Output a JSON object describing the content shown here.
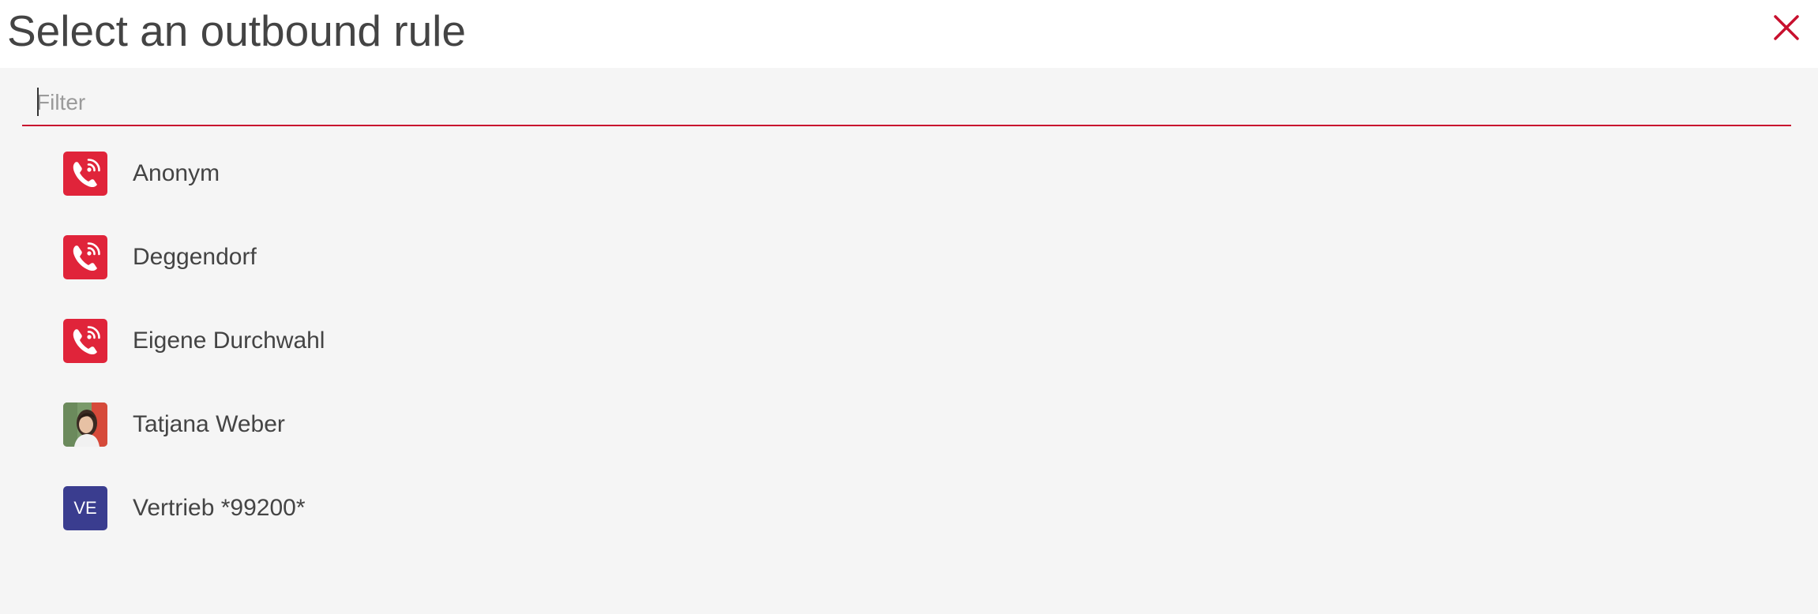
{
  "dialog": {
    "title": "Select an outbound rule",
    "close_icon": "close-icon",
    "accent_color": "#c8102e"
  },
  "filter": {
    "placeholder": "Filter",
    "value": ""
  },
  "items": [
    {
      "label": "Anonym",
      "icon": "phone-outbound-icon",
      "avatar_type": "rule"
    },
    {
      "label": "Deggendorf",
      "icon": "phone-outbound-icon",
      "avatar_type": "rule"
    },
    {
      "label": "Eigene Durchwahl",
      "icon": "phone-outbound-icon",
      "avatar_type": "rule"
    },
    {
      "label": "Tatjana Weber",
      "icon": "user-photo",
      "avatar_type": "photo"
    },
    {
      "label": "Vertrieb *99200*",
      "avatar_type": "initials",
      "initials": "VE",
      "color": "#3a3d8f"
    }
  ]
}
